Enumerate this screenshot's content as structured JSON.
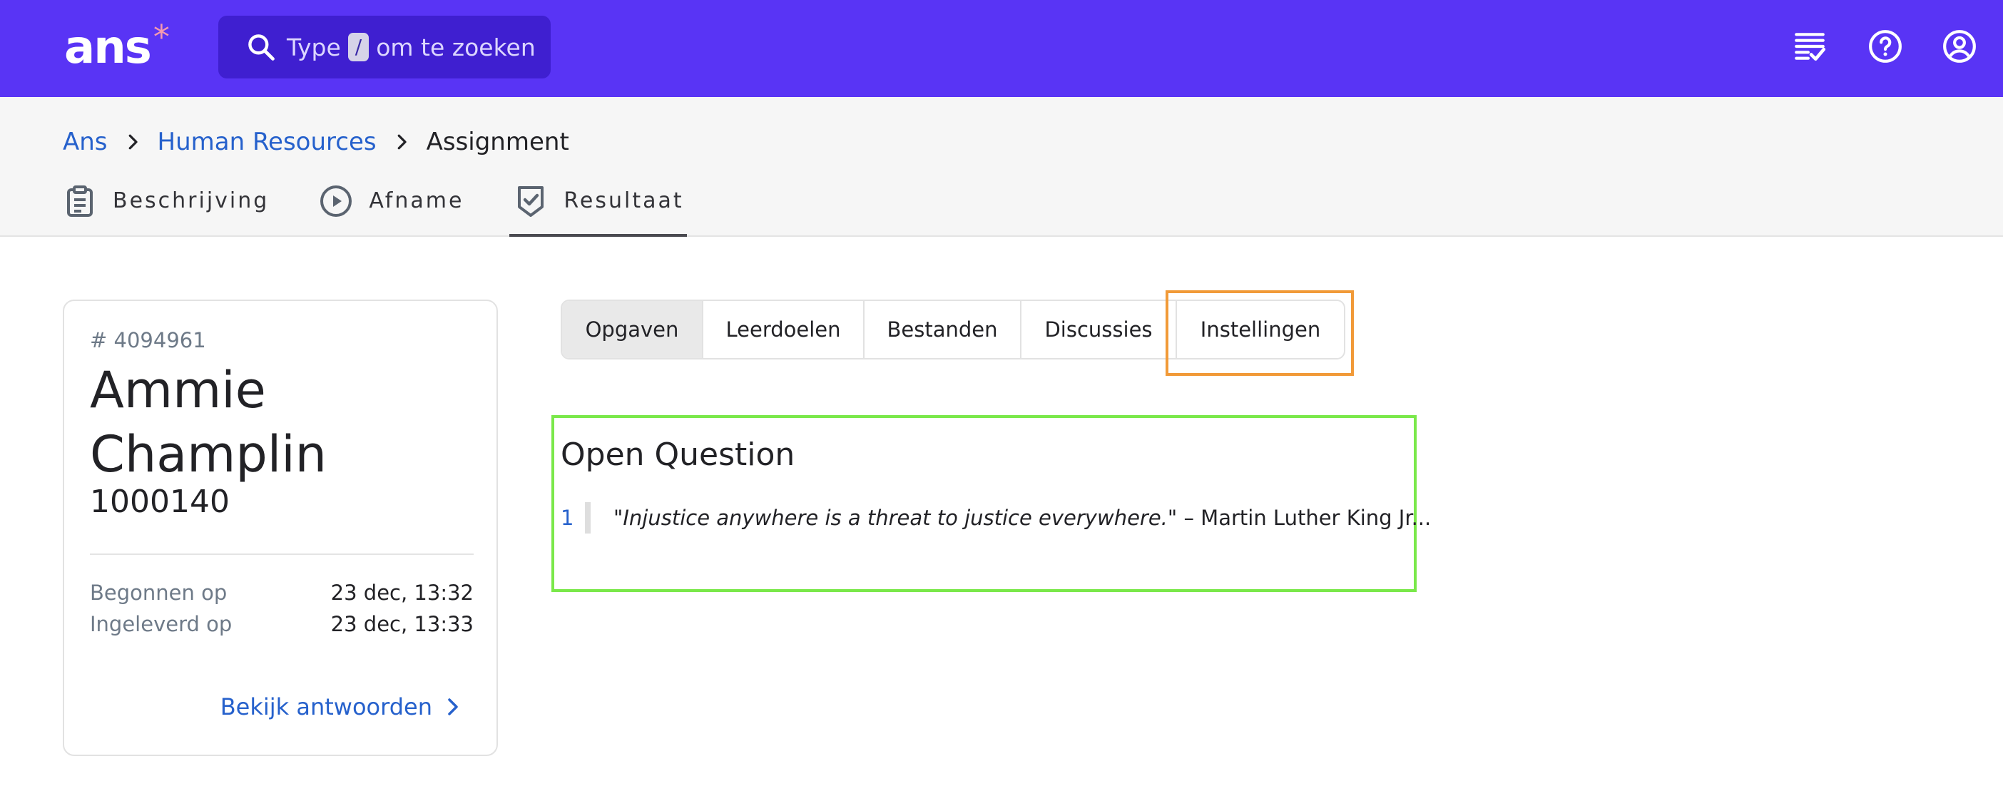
{
  "app": {
    "logo_text": "ans",
    "logo_star": "*"
  },
  "search": {
    "prefix": "Type",
    "key": "/",
    "suffix": "om te zoeken"
  },
  "topbar_icons": [
    "checklist-icon",
    "help-icon",
    "account-icon"
  ],
  "breadcrumb": {
    "items": [
      {
        "label": "Ans",
        "link": true
      },
      {
        "label": "Human Resources",
        "link": true
      },
      {
        "label": "Assignment",
        "link": false
      }
    ]
  },
  "main_tabs": [
    {
      "label": "Beschrijving",
      "icon": "clipboard-icon",
      "active": false
    },
    {
      "label": "Afname",
      "icon": "play-circle-icon",
      "active": false
    },
    {
      "label": "Resultaat",
      "icon": "shield-check-icon",
      "active": true
    }
  ],
  "student_card": {
    "id": "# 4094961",
    "name": "Ammie Champlin",
    "number": "1000140",
    "started_label": "Begonnen op",
    "started_value": "23 dec, 13:32",
    "submitted_label": "Ingeleverd op",
    "submitted_value": "23 dec, 13:33",
    "link_label": "Bekijk antwoorden"
  },
  "segment_tabs": [
    {
      "label": "Opgaven",
      "active": true
    },
    {
      "label": "Leerdoelen",
      "active": false
    },
    {
      "label": "Bestanden",
      "active": false
    },
    {
      "label": "Discussies",
      "active": false
    },
    {
      "label": "Instellingen",
      "active": false
    }
  ],
  "question": {
    "title": "Open Question",
    "number": "1",
    "quote": "\"Injustice anywhere is a threat to justice everywhere.\"",
    "rest": " – Martin Luther King Jr..."
  },
  "colors": {
    "brand": "#5934f5",
    "link": "#2661cc",
    "highlight_orange": "#f19a38",
    "highlight_green": "#7ae84a"
  }
}
